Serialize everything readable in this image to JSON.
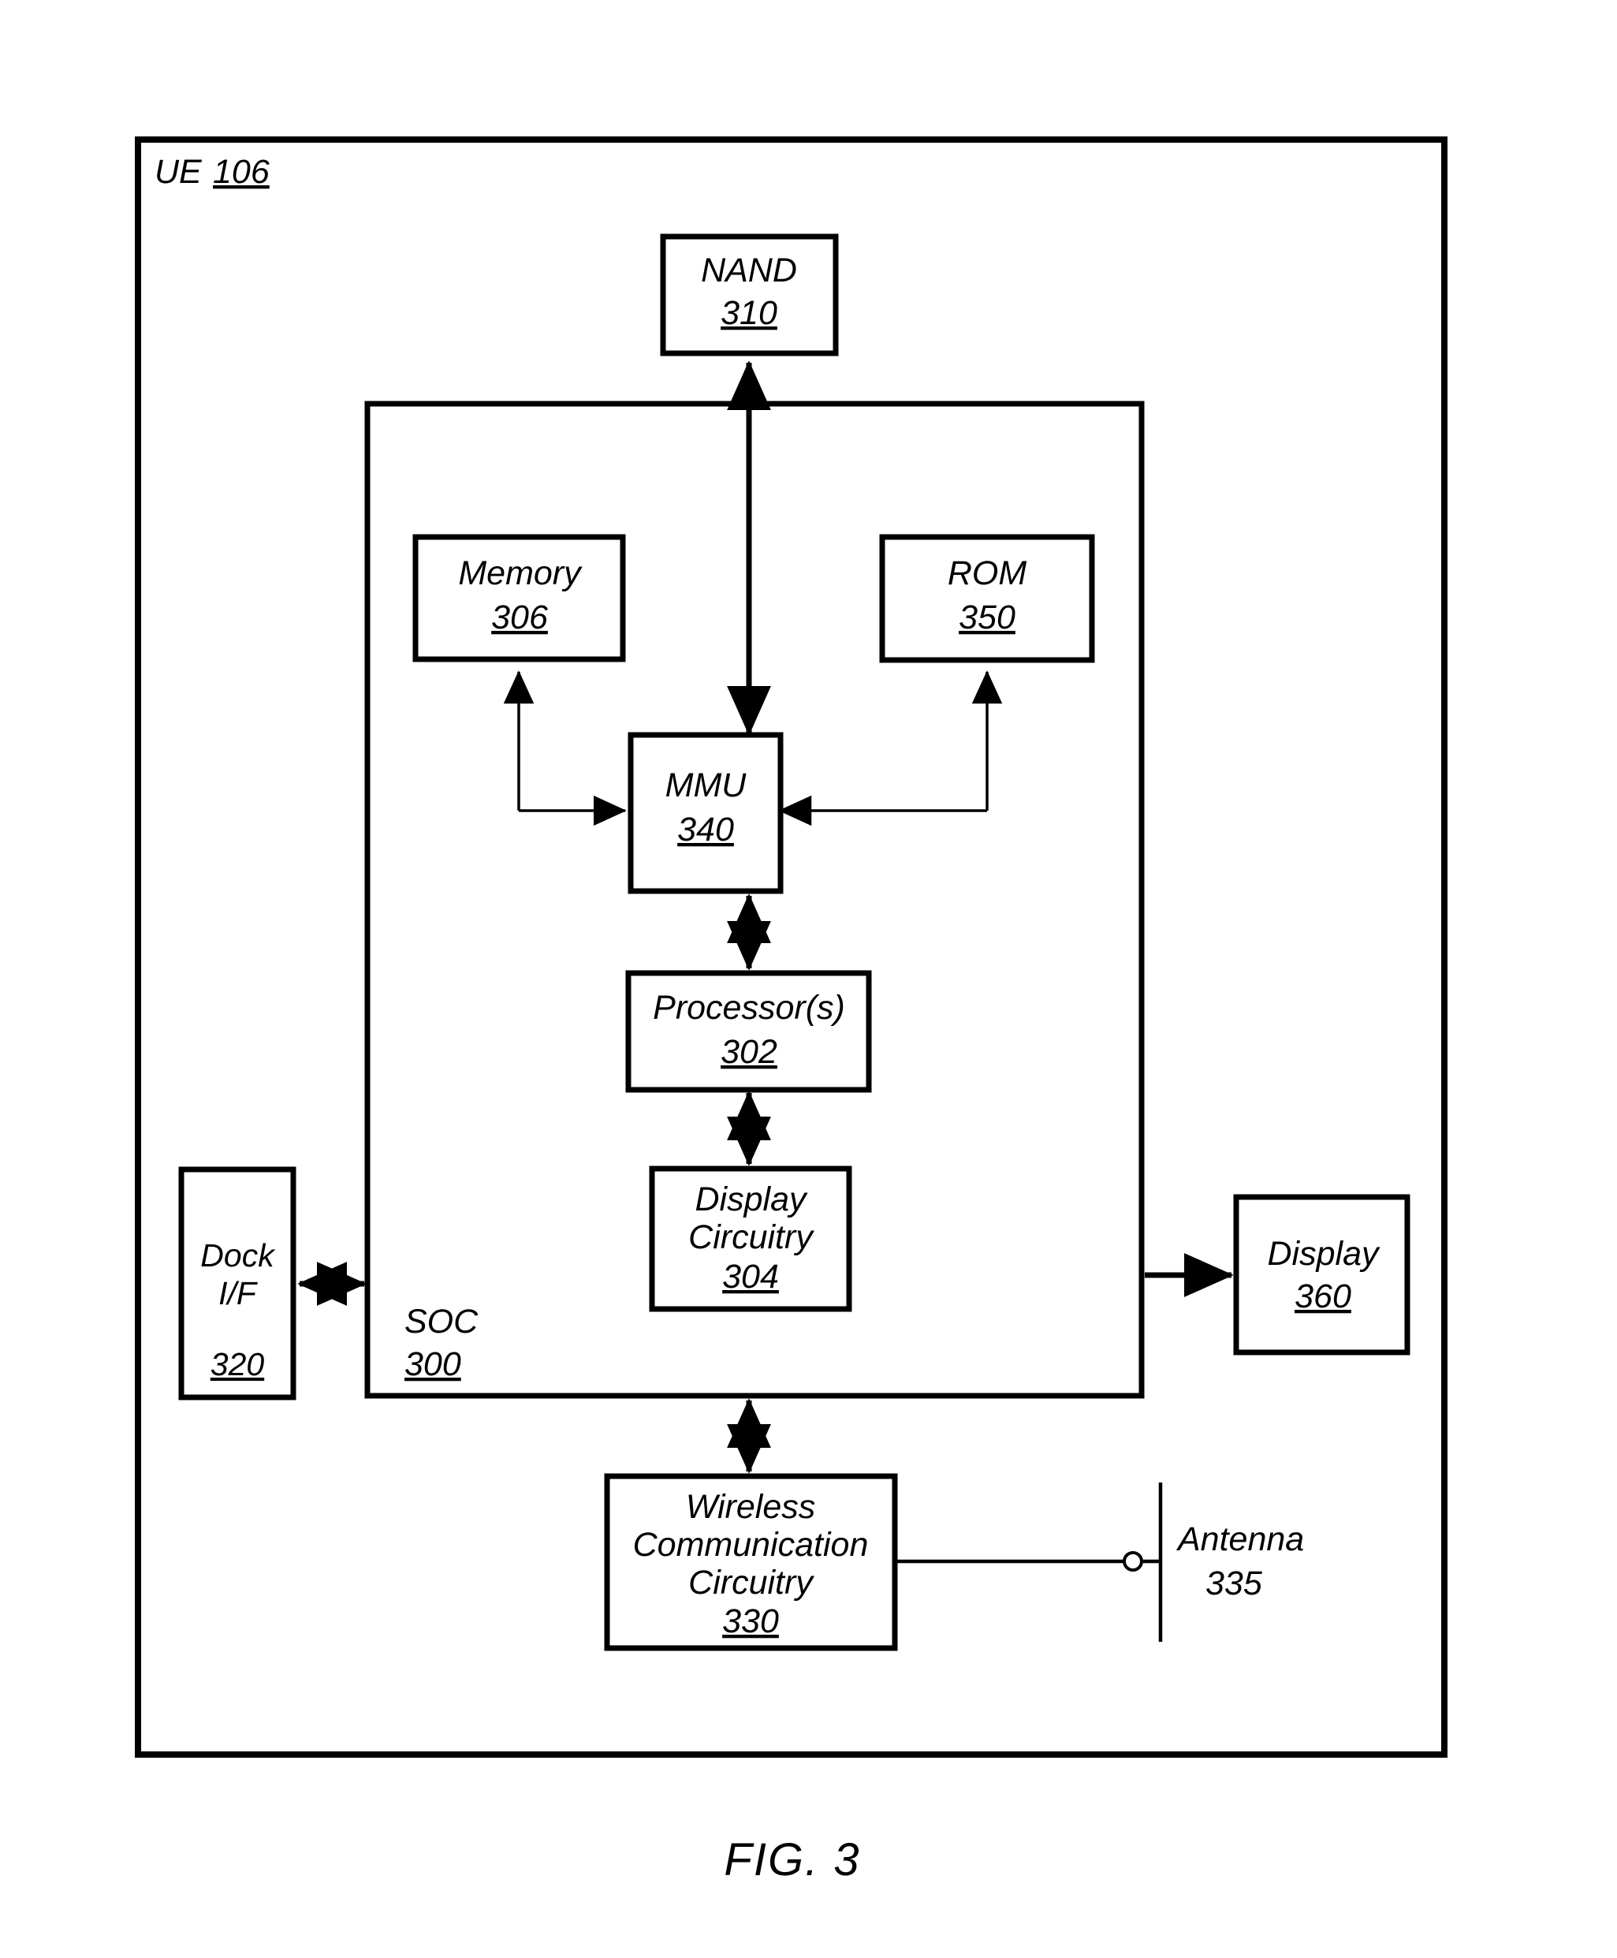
{
  "figure": {
    "caption": "FIG. 3",
    "outer": {
      "label": "UE",
      "ref": "106"
    },
    "soc": {
      "label": "SOC",
      "ref": "300"
    },
    "blocks": [
      {
        "id": "nand",
        "label": "NAND",
        "lines": [
          "NAND"
        ],
        "ref": "310"
      },
      {
        "id": "memory",
        "label": "Memory",
        "lines": [
          "Memory"
        ],
        "ref": "306"
      },
      {
        "id": "rom",
        "label": "ROM",
        "lines": [
          "ROM"
        ],
        "ref": "350"
      },
      {
        "id": "mmu",
        "label": "MMU",
        "lines": [
          "MMU"
        ],
        "ref": "340"
      },
      {
        "id": "processors",
        "label": "Processor(s)",
        "lines": [
          "Processor(s)"
        ],
        "ref": "302"
      },
      {
        "id": "display-ckt",
        "label": "Display Circuitry",
        "lines": [
          "Display",
          "Circuitry"
        ],
        "ref": "304"
      },
      {
        "id": "dock-if",
        "label": "Dock I/F",
        "lines": [
          "Dock",
          "I/F"
        ],
        "ref": "320"
      },
      {
        "id": "display",
        "label": "Display",
        "lines": [
          "Display"
        ],
        "ref": "360"
      },
      {
        "id": "wireless",
        "label": "Wireless Communication Circuitry",
        "lines": [
          "Wireless",
          "Communication",
          "Circuitry"
        ],
        "ref": "330"
      }
    ],
    "antenna": {
      "label": "Antenna",
      "ref": "335"
    },
    "colors": {
      "stroke": "#000000",
      "background": "#ffffff"
    }
  }
}
